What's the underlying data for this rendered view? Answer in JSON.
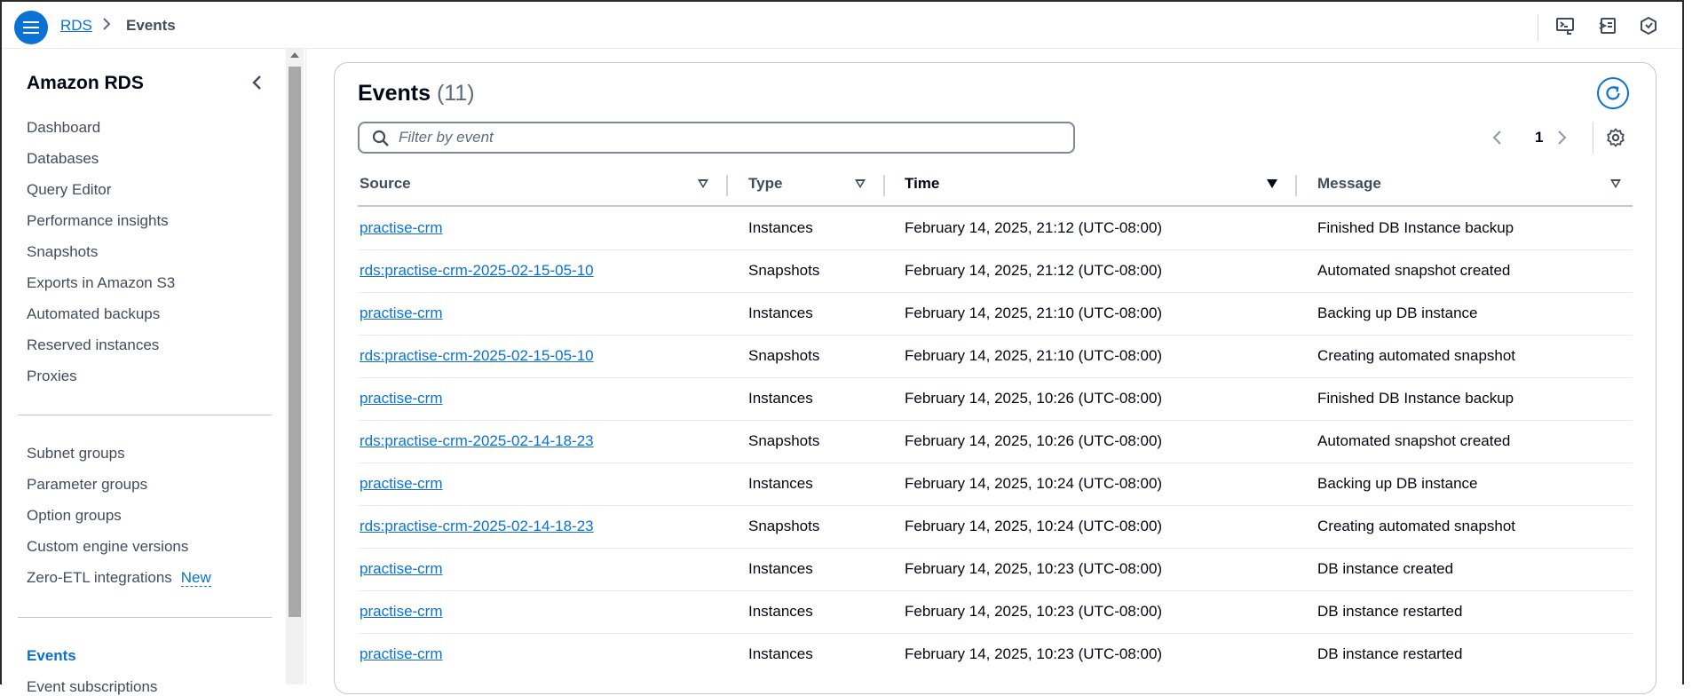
{
  "header": {
    "breadcrumb_root": "RDS",
    "breadcrumb_current": "Events"
  },
  "sidebar": {
    "title": "Amazon RDS",
    "group1": [
      "Dashboard",
      "Databases",
      "Query Editor",
      "Performance insights",
      "Snapshots",
      "Exports in Amazon S3",
      "Automated backups",
      "Reserved instances",
      "Proxies"
    ],
    "group2": [
      "Subnet groups",
      "Parameter groups",
      "Option groups",
      "Custom engine versions",
      "Zero-ETL integrations"
    ],
    "new_badge": "New",
    "group3": [
      "Events",
      "Event subscriptions"
    ]
  },
  "events": {
    "title": "Events",
    "count": "(11)",
    "filter_placeholder": "Filter by event",
    "page": "1",
    "columns": [
      "Source",
      "Type",
      "Time",
      "Message"
    ],
    "rows": [
      {
        "source": "practise-crm",
        "type": "Instances",
        "time": "February 14, 2025, 21:12 (UTC-08:00)",
        "message": "Finished DB Instance backup"
      },
      {
        "source": "rds:practise-crm-2025-02-15-05-10",
        "type": "Snapshots",
        "time": "February 14, 2025, 21:12 (UTC-08:00)",
        "message": "Automated snapshot created"
      },
      {
        "source": "practise-crm",
        "type": "Instances",
        "time": "February 14, 2025, 21:10 (UTC-08:00)",
        "message": "Backing up DB instance"
      },
      {
        "source": "rds:practise-crm-2025-02-15-05-10",
        "type": "Snapshots",
        "time": "February 14, 2025, 21:10 (UTC-08:00)",
        "message": "Creating automated snapshot"
      },
      {
        "source": "practise-crm",
        "type": "Instances",
        "time": "February 14, 2025, 10:26 (UTC-08:00)",
        "message": "Finished DB Instance backup"
      },
      {
        "source": "rds:practise-crm-2025-02-14-18-23",
        "type": "Snapshots",
        "time": "February 14, 2025, 10:26 (UTC-08:00)",
        "message": "Automated snapshot created"
      },
      {
        "source": "practise-crm",
        "type": "Instances",
        "time": "February 14, 2025, 10:24 (UTC-08:00)",
        "message": "Backing up DB instance"
      },
      {
        "source": "rds:practise-crm-2025-02-14-18-23",
        "type": "Snapshots",
        "time": "February 14, 2025, 10:24 (UTC-08:00)",
        "message": "Creating automated snapshot"
      },
      {
        "source": "practise-crm",
        "type": "Instances",
        "time": "February 14, 2025, 10:23 (UTC-08:00)",
        "message": "DB instance created"
      },
      {
        "source": "practise-crm",
        "type": "Instances",
        "time": "February 14, 2025, 10:23 (UTC-08:00)",
        "message": "DB instance restarted"
      },
      {
        "source": "practise-crm",
        "type": "Instances",
        "time": "February 14, 2025, 10:23 (UTC-08:00)",
        "message": "DB instance restarted"
      }
    ]
  },
  "colors": {
    "accent": "#0972d3",
    "text": "#000716",
    "muted": "#414d5c"
  },
  "icons": [
    "menu-icon",
    "chevron-right-icon",
    "cloudshell-icon",
    "feedback-icon",
    "notifications-icon",
    "collapse-left-icon",
    "refresh-icon",
    "search-icon",
    "chevron-left-icon",
    "settings-icon",
    "sort-icon"
  ]
}
